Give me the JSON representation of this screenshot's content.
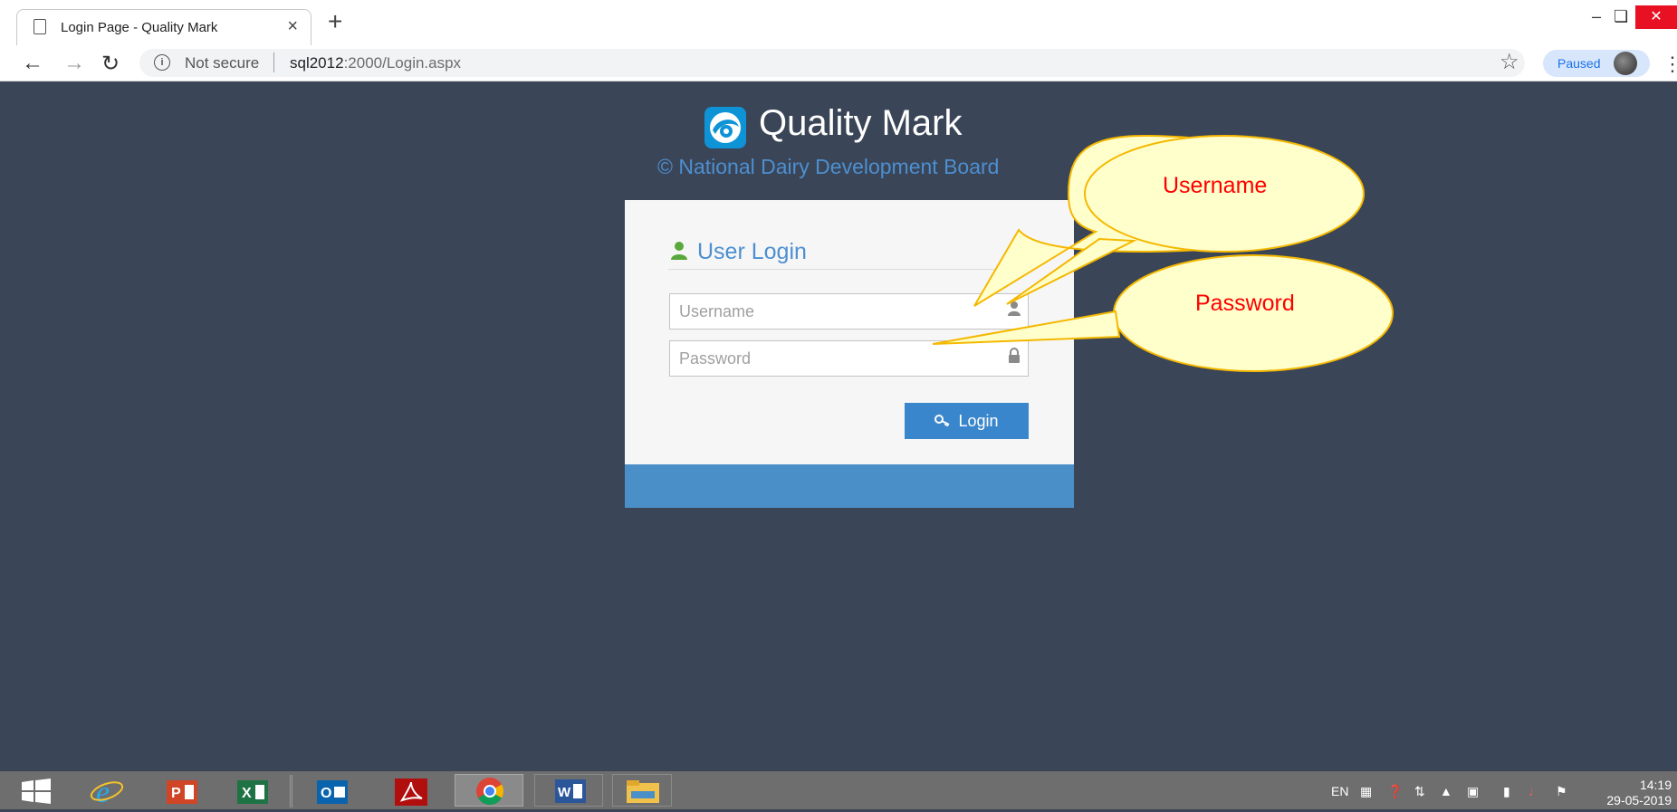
{
  "browser": {
    "tab_title": "Login Page - Quality Mark",
    "tab_close": "×",
    "new_tab": "+",
    "omnibox": {
      "security": "Not secure",
      "host": "sql2012",
      "path": ":2000/Login.aspx"
    },
    "profile_status": "Paused"
  },
  "page": {
    "title": "Quality Mark",
    "subtitle": "© National Dairy Development Board",
    "panel_heading": "User Login",
    "username_placeholder": "Username",
    "password_placeholder": "Password",
    "login_label": "Login"
  },
  "callouts": {
    "username": "Username",
    "password": "Password"
  },
  "taskbar": {
    "lang": "EN",
    "time": "14:19",
    "date": "29-05-2019"
  },
  "colors": {
    "page_bg": "#3a4557",
    "accent_blue": "#3a86cc",
    "callout_fill": "#ffffcc",
    "callout_border": "#f5b800",
    "callout_text": "#ff0000"
  }
}
